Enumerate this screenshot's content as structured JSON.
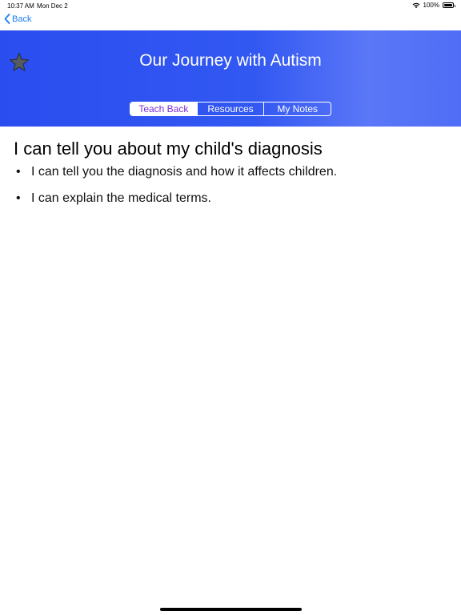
{
  "status_bar": {
    "time": "10:37 AM",
    "date": "Mon Dec 2",
    "battery": "100%",
    "battery_level": 1.0,
    "wifi_icon": "wifi-icon"
  },
  "nav": {
    "back_label": "Back",
    "back_icon": "chevron-left-icon",
    "accent_color": "#1a7ff0"
  },
  "header": {
    "title": "Our Journey with Autism",
    "star_icon": "star-icon",
    "gradient": [
      "#2a4df0",
      "#5a77f7"
    ]
  },
  "tabs": [
    {
      "label": "Teach Back",
      "selected": true
    },
    {
      "label": "Resources",
      "selected": false
    },
    {
      "label": "My Notes",
      "selected": false
    }
  ],
  "tab_selected_color": "#7b2fd8",
  "content": {
    "heading": "I can tell you about my child's diagnosis",
    "bullets": [
      "I can tell you the diagnosis and how it affects children.",
      "I can explain the medical terms."
    ]
  }
}
